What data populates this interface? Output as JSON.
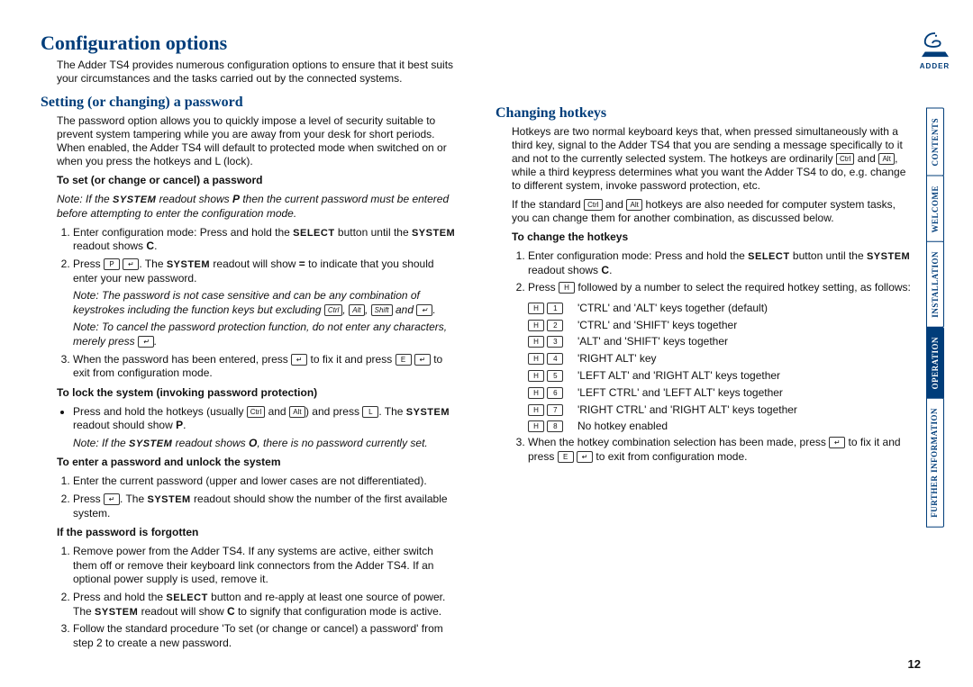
{
  "brand": "ADDER",
  "page_number": "12",
  "nav": {
    "items": [
      {
        "label": "CONTENTS",
        "active": false
      },
      {
        "label": "WELCOME",
        "active": false
      },
      {
        "label": "INSTALLATION",
        "active": false
      },
      {
        "label": "OPERATION",
        "active": true
      },
      {
        "label": "FURTHER INFORMATION",
        "active": false
      }
    ]
  },
  "left": {
    "h1": "Configuration options",
    "intro": "The Adder TS4 provides numerous configuration options to ensure that it best suits your circumstances and the tasks carried out by the connected systems.",
    "h2": "Setting (or changing) a password",
    "password_intro": "The password option allows you to quickly impose a level of security suitable to prevent system tampering while you are away from your desk for short periods. When enabled, the Adder TS4 will default to protected mode when switched on or when you press the hotkeys and L (lock).",
    "set_heading": "To set (or change or cancel) a password",
    "set_note_prefix": "Note: If the ",
    "set_note_sc": "SYSTEM",
    "set_note_mid": " readout shows ",
    "set_note_P": "P",
    "set_note_after": " then the current password must be entered before attempting to enter the configuration mode.",
    "set_step1_a": "Enter configuration mode: Press and hold the ",
    "set_step1_sc": "SELECT",
    "set_step1_b": " button until the ",
    "set_step1_sc2": "SYSTEM",
    "set_step1_c": " readout shows ",
    "set_step1_glyph": "C",
    "set_step1_d": ".",
    "set_step2_a": "Press ",
    "set_step2_b": ". The ",
    "set_step2_sc": "SYSTEM",
    "set_step2_c": " readout will show ",
    "set_step2_eq": "=",
    "set_step2_d": " to indicate that you should enter your new password.",
    "set_note2": "Note: The password is not case sensitive and can be any combination of keystrokes including the function keys but excluding ",
    "set_note2_end": " and ",
    "set_note3": "Note: To cancel the password protection function, do not enter any characters, merely press ",
    "set_step3_a": "When the password has been entered, press ",
    "set_step3_b": " to fix it and press ",
    "set_step3_c": " to exit from configuration mode.",
    "lock_heading": "To lock the system (invoking password protection)",
    "lock_bullet_a": "Press and hold the hotkeys (usually ",
    "lock_bullet_mid": " and ",
    "lock_bullet_b": ") and press ",
    "lock_bullet_c": ". The ",
    "lock_bullet_sc": "SYSTEM",
    "lock_bullet_d": " readout should show ",
    "lock_bullet_P": "P",
    "lock_bullet_e": ".",
    "lock_note_a": "Note: If the ",
    "lock_note_sc": "SYSTEM",
    "lock_note_b": " readout shows ",
    "lock_note_glyph": "O",
    "lock_note_c": ", there is no password currently set.",
    "enter_heading": "To enter a password and unlock the system",
    "enter_step1": "Enter the current password (upper and lower cases are not differentiated).",
    "enter_step2_a": "Press ",
    "enter_step2_b": ". The ",
    "enter_step2_sc": "SYSTEM",
    "enter_step2_c": " readout should show the number of the first available system.",
    "forgot_heading": "If the password is forgotten",
    "forgot_step1": "Remove power from the Adder TS4. If any systems are active, either switch them off or remove their keyboard link connectors from the Adder TS4. If an optional power supply is used, remove it.",
    "forgot_step2_a": "Press and hold the ",
    "forgot_step2_sc": "SELECT",
    "forgot_step2_b": " button and re-apply at least one source of power. The ",
    "forgot_step2_sc2": "SYSTEM",
    "forgot_step2_c": " readout will show ",
    "forgot_step2_glyph": "C",
    "forgot_step2_d": " to signify that configuration mode is active.",
    "forgot_step3": "Follow the standard procedure 'To set (or change or cancel) a password' from step 2 to create a new password."
  },
  "right": {
    "h2": "Changing hotkeys",
    "intro_a": "Hotkeys are two normal keyboard keys that, when pressed simultaneously with a third key, signal to the Adder TS4 that you are sending a message specifically to it and not to the currently selected system. The hotkeys are ordinarily ",
    "intro_mid": " and ",
    "intro_b": ", while a third keypress determines what you want the Adder TS4 to do, e.g. change to different system, invoke password protection, etc.",
    "intro2_a": "If the standard ",
    "intro2_mid": " and ",
    "intro2_b": " hotkeys are also needed for computer system tasks, you can change them for another combination, as discussed below.",
    "change_heading": "To change the hotkeys",
    "change_step1_a": "Enter configuration mode: Press and hold the ",
    "change_step1_sc": "SELECT",
    "change_step1_b": " button until the ",
    "change_step1_sc2": "SYSTEM",
    "change_step1_c": " readout shows ",
    "change_step1_glyph": "C",
    "change_step1_d": ".",
    "change_step2_a": "Press ",
    "change_step2_b": " followed by a number to select the required hotkey setting, as follows:",
    "options": [
      {
        "k1": "H",
        "k2": "1",
        "label": "'CTRL' and 'ALT' keys together (default)"
      },
      {
        "k1": "H",
        "k2": "2",
        "label": "'CTRL' and 'SHIFT' keys together"
      },
      {
        "k1": "H",
        "k2": "3",
        "label": "'ALT' and 'SHIFT' keys together"
      },
      {
        "k1": "H",
        "k2": "4",
        "label": "'RIGHT ALT' key"
      },
      {
        "k1": "H",
        "k2": "5",
        "label": "'LEFT ALT' and 'RIGHT ALT' keys together"
      },
      {
        "k1": "H",
        "k2": "6",
        "label": "'LEFT CTRL' and 'LEFT ALT' keys together"
      },
      {
        "k1": "H",
        "k2": "7",
        "label": "'RIGHT CTRL' and 'RIGHT ALT' keys together"
      },
      {
        "k1": "H",
        "k2": "8",
        "label": "No hotkey enabled"
      }
    ],
    "change_step3_a": "When the hotkey combination selection has been made, press ",
    "change_step3_b": " to fix it and press ",
    "change_step3_c": " to exit from configuration mode."
  },
  "keys": {
    "P": "P",
    "enter": "↵",
    "E": "E",
    "L": "L",
    "H": "H",
    "Ctrl": "Ctrl",
    "Alt": "Alt",
    "Shift": "Shift"
  }
}
